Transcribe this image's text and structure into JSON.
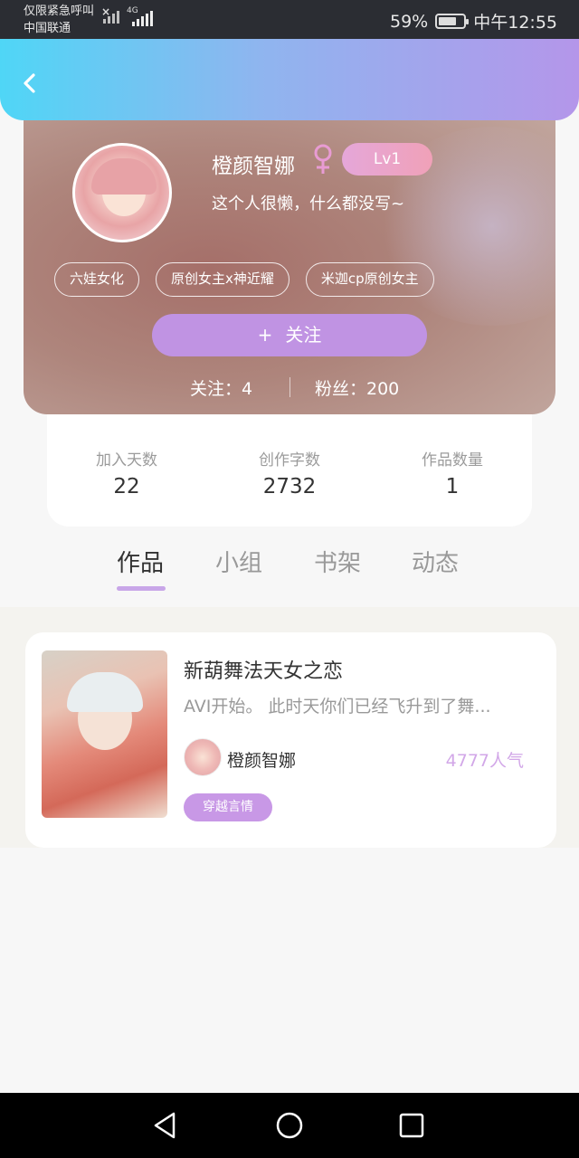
{
  "status_bar": {
    "carrier_line1": "仅限紧急呼叫",
    "carrier_line2": "中国联通",
    "network": "4G",
    "battery": "59%",
    "time": "中午12:55"
  },
  "profile": {
    "name": "橙颜智娜",
    "gender_icon": "female-icon",
    "level": "Lv1",
    "bio": "这个人很懒，什么都没写~",
    "tags": [
      "六娃女化",
      "原创女主x神近耀",
      "米迦cp原创女主"
    ],
    "follow_label": "关注",
    "following": "关注：4",
    "followers": "粉丝：200"
  },
  "metrics": [
    {
      "label": "加入天数",
      "value": "22"
    },
    {
      "label": "创作字数",
      "value": "2732"
    },
    {
      "label": "作品数量",
      "value": "1"
    }
  ],
  "tabs": [
    "作品",
    "小组",
    "书架",
    "动态"
  ],
  "active_tab": "作品",
  "works": [
    {
      "title": "新葫舞法天女之恋",
      "desc": "AVI开始。 此时天你们已经飞升到了舞...",
      "author": "橙颜智娜",
      "popularity": "4777人气",
      "tag": "穿越言情"
    }
  ],
  "colors": {
    "accent": "#c093e3",
    "header_start": "#4fd6f6",
    "header_end": "#b496ea",
    "popularity": "#d2a7e8"
  }
}
